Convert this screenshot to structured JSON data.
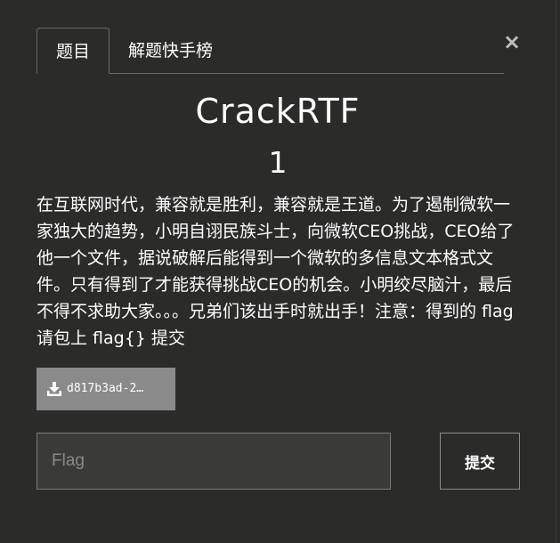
{
  "tabs": [
    {
      "label": "题目",
      "active": true
    },
    {
      "label": "解题快手榜",
      "active": false
    }
  ],
  "close_label": "×",
  "challenge": {
    "name": "CrackRTF",
    "points": "1",
    "description": "在互联网时代，兼容就是胜利，兼容就是王道。为了遏制微软一家独大的趋势，小明自诩民族斗士，向微软CEO挑战，CEO给了他一个文件，据说破解后能得到一个微软的多信息文本格式文件。只有得到了才能获得挑战CEO的机会。小明绞尽脑汁，最后不得不求助大家。。。兄弟们该出手时就出手！注意：得到的 flag 请包上 flag{} 提交"
  },
  "file": {
    "name": "d817b3ad-2…",
    "icon": "download-icon"
  },
  "flag_input": {
    "placeholder": "Flag",
    "value": ""
  },
  "submit_label": "提交",
  "colors": {
    "background": "#2b2b2a",
    "file_button": "#8a8a8a",
    "input_background": "#3a3a39"
  }
}
